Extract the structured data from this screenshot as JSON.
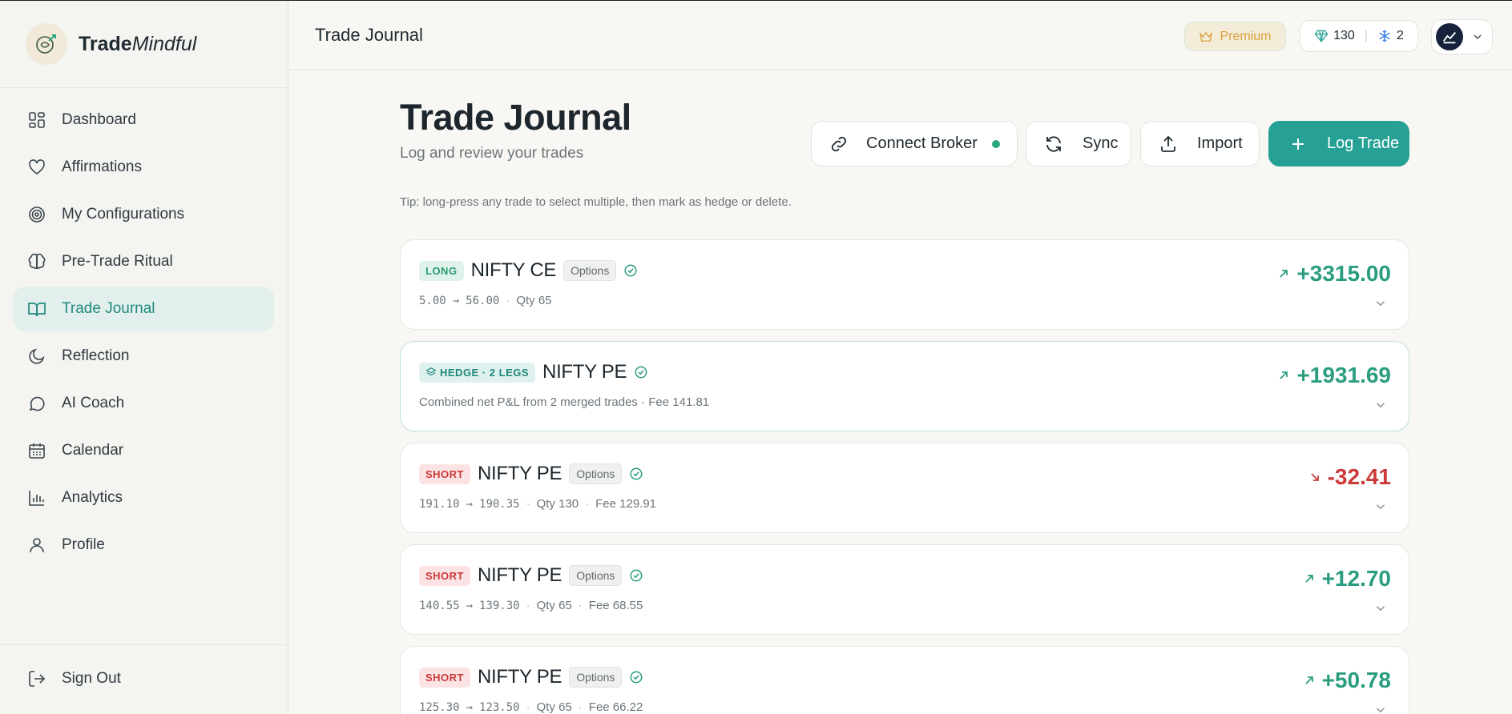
{
  "brand": {
    "name_bold": "Trade",
    "name_italic": "Mindful",
    "logo_icon": "leaf-brain-logo"
  },
  "sidebar": {
    "items": [
      {
        "label": "Dashboard",
        "icon": "grid-icon",
        "active": false
      },
      {
        "label": "Affirmations",
        "icon": "heart-icon",
        "active": false
      },
      {
        "label": "My Configurations",
        "icon": "target-icon",
        "active": false
      },
      {
        "label": "Pre-Trade Ritual",
        "icon": "brain-icon",
        "active": false
      },
      {
        "label": "Trade Journal",
        "icon": "book-icon",
        "active": true
      },
      {
        "label": "Reflection",
        "icon": "moon-icon",
        "active": false
      },
      {
        "label": "AI Coach",
        "icon": "chat-icon",
        "active": false
      },
      {
        "label": "Calendar",
        "icon": "calendar-icon",
        "active": false
      },
      {
        "label": "Analytics",
        "icon": "bar-chart-icon",
        "active": false
      },
      {
        "label": "Profile",
        "icon": "user-icon",
        "active": false
      }
    ],
    "sign_out": "Sign Out"
  },
  "topbar": {
    "title": "Trade Journal",
    "premium_label": "Premium",
    "gems_count": "130",
    "freeze_count": "2"
  },
  "main": {
    "title": "Trade Journal",
    "subtitle": "Log and review your trades",
    "buttons": {
      "connect_broker": "Connect Broker",
      "sync": "Sync",
      "import": "Import",
      "log_trade": "Log Trade"
    },
    "tip": "Tip: long-press any trade to select multiple, then mark as hedge or delete."
  },
  "trades": [
    {
      "side": "LONG",
      "symbol": "NIFTY CE",
      "chip": "Options",
      "entry": "5.00",
      "exit": "56.00",
      "qty": "Qty 65",
      "fee": "",
      "pnl": "+3315.00",
      "positive": true
    },
    {
      "side": "HEDGE · 2 LEGS",
      "symbol": "NIFTY PE",
      "chip": "",
      "detail": "Combined net P&L from 2 merged trades · Fee 141.81",
      "pnl": "+1931.69",
      "positive": true
    },
    {
      "side": "SHORT",
      "symbol": "NIFTY PE",
      "chip": "Options",
      "entry": "191.10",
      "exit": "190.35",
      "qty": "Qty 130",
      "fee": "Fee 129.91",
      "pnl": "-32.41",
      "positive": false
    },
    {
      "side": "SHORT",
      "symbol": "NIFTY PE",
      "chip": "Options",
      "entry": "140.55",
      "exit": "139.30",
      "qty": "Qty 65",
      "fee": "Fee 68.55",
      "pnl": "+12.70",
      "positive": true
    },
    {
      "side": "SHORT",
      "symbol": "NIFTY PE",
      "chip": "Options",
      "entry": "125.30",
      "exit": "123.50",
      "qty": "Qty 65",
      "fee": "Fee 66.22",
      "pnl": "+50.78",
      "positive": true
    }
  ],
  "colors": {
    "accent": "#27a195",
    "positive": "#2a9d80",
    "negative": "#cc3a3a",
    "premium": "#d9a23e"
  }
}
